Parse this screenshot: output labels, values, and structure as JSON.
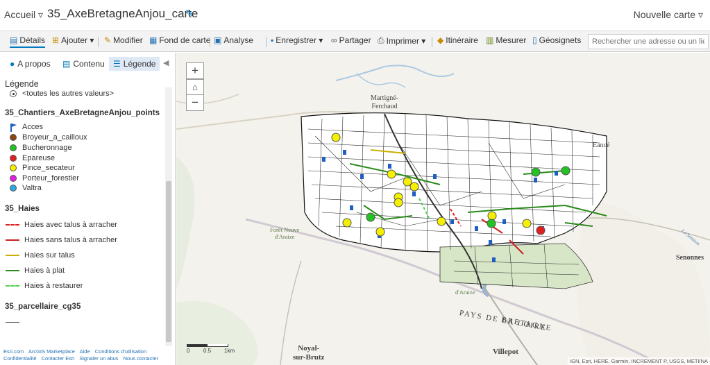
{
  "titlebar": {
    "home_label": "Accueil ▿",
    "map_title": "35_AxeBretagneAnjou_carte",
    "new_map_label": "Nouvelle carte ▿"
  },
  "toolbar": {
    "details": "Détails",
    "add": "Ajouter ▾",
    "modify": "Modifier",
    "basemap": "Fond de carte",
    "analysis": "Analyse",
    "save": "Enregistrer ▾",
    "share": "Partager",
    "print": "Imprimer ▾",
    "route": "Itinéraire",
    "measure": "Mesurer",
    "bookmarks": "Géosignets",
    "search_placeholder": "Rechercher une adresse ou un lieu"
  },
  "panel": {
    "tabs": {
      "about": "A propos",
      "content": "Contenu",
      "legend": "Légende"
    },
    "legend_title": "Légende",
    "other_values": "<toutes les autres valeurs>",
    "layers": [
      {
        "name": "35_Chantiers_AxeBretagneAnjou_points",
        "items": [
          {
            "label": "Acces",
            "color": "#1f5fbf",
            "type": "flag"
          },
          {
            "label": "Broyeur_a_cailloux",
            "color": "#8b4513",
            "type": "dot"
          },
          {
            "label": "Bucheronnage",
            "color": "#22c322",
            "type": "dot"
          },
          {
            "label": "Epareuse",
            "color": "#e02020",
            "type": "dot"
          },
          {
            "label": "Pince_secateur",
            "color": "#f4f000",
            "type": "dot"
          },
          {
            "label": "Porteur_forestier",
            "color": "#e020e0",
            "type": "dot"
          },
          {
            "label": "Valtra",
            "color": "#2aa9e0",
            "type": "dot"
          }
        ]
      },
      {
        "name": "35_Haies",
        "items": [
          {
            "label": "Haies avec talus à arracher",
            "color": "#e02020",
            "type": "dashed"
          },
          {
            "label": "Haies sans talus à arracher",
            "color": "#c82020",
            "type": "solid"
          },
          {
            "label": "Haies sur talus",
            "color": "#c9b000",
            "type": "solid"
          },
          {
            "label": "Haies à plat",
            "color": "#2a8a1a",
            "type": "solid"
          },
          {
            "label": "Haies à restaurer",
            "color": "#4ad24a",
            "type": "dashed"
          }
        ]
      },
      {
        "name": "35_parcellaire_cg35",
        "items": [
          {
            "label": "",
            "color": "#555555",
            "type": "solid"
          }
        ]
      }
    ],
    "footer_links": [
      "Esri.com",
      "ArcGIS Marketplace",
      "Aide",
      "Conditions d'utilisation",
      "Confidentialité",
      "Contacter Esri",
      "Signaler un abus",
      "Nous contacter"
    ]
  },
  "map": {
    "zoom_in": "+",
    "zoom_out": "−",
    "labels": {
      "martigne": "Martigné-\nFerchaud",
      "ence": "Eancé",
      "foret": "Forêt Neuve\nd'Araize",
      "araize": "d'Araize",
      "pays": "PAYS DE LA LOIRE",
      "bretagne": "BRETAGNE",
      "noyal": "Noyal-\nsur-Brutz",
      "villepot": "Villepot",
      "senonnes": "Senonnes",
      "semnon": "La Semnon"
    },
    "scale": {
      "ticks": [
        "0",
        "0.5",
        "1km"
      ]
    },
    "attribution": "IGN, Esri, HERE, Garmin, INCREMENT P, USGS, METI/NA"
  }
}
